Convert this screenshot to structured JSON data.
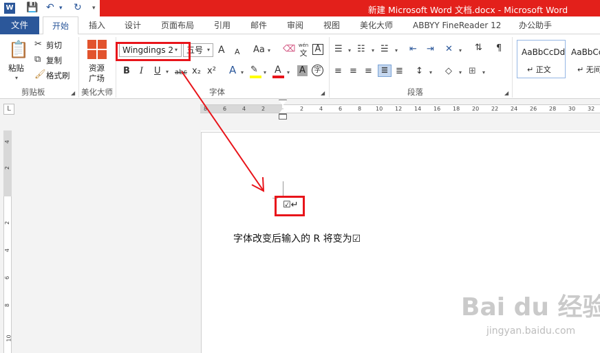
{
  "title_bar": {
    "title": "新建 Microsoft Word 文档.docx - Microsoft Word"
  },
  "tabs": [
    "文件",
    "开始",
    "插入",
    "设计",
    "页面布局",
    "引用",
    "邮件",
    "审阅",
    "视图",
    "美化大师",
    "ABBYY FineReader 12",
    "办公助手"
  ],
  "clipboard": {
    "paste": "粘贴",
    "cut": "剪切",
    "copy": "复制",
    "format_painter": "格式刷",
    "label": "剪贴板"
  },
  "beautify": {
    "resource_line1": "资源",
    "resource_line2": "广场",
    "label": "美化大师"
  },
  "font": {
    "name": "Wingdings 2",
    "size": "五号",
    "label": "字体",
    "grow": "A",
    "shrink": "A",
    "case": "Aa",
    "bold": "B",
    "italic": "I",
    "underline": "U",
    "strike": "abc",
    "sub": "x₂",
    "sup": "x²",
    "effects": "A",
    "color": "A",
    "char_shade": "A",
    "enclose": "字",
    "phonetic_top": "wén",
    "phonetic_main": "文",
    "char_border": "A"
  },
  "paragraph": {
    "label": "段落"
  },
  "styles": {
    "normal_sample": "AaBbCcDd",
    "normal_name": "↵ 正文",
    "nospace_sample": "AaBbCc",
    "nospace_name": "↵ 无间"
  },
  "ruler": {
    "top": [
      "8",
      "6",
      "4",
      "2",
      "2",
      "4",
      "6",
      "8",
      "10",
      "12",
      "14",
      "16",
      "18",
      "20",
      "22",
      "24",
      "26",
      "28",
      "30",
      "32"
    ],
    "left": [
      "4",
      "2",
      "2",
      "4",
      "6",
      "8",
      "10"
    ]
  },
  "document": {
    "symbol": "☑↵",
    "caption": "字体改变后输入的 R 将变为☑"
  },
  "watermark": {
    "main": "Bai du 经验",
    "sub": "jingyan.baidu.com"
  },
  "colors": {
    "title_red": "#e3201b",
    "accent": "#2b579a",
    "highlight": "#e8141a"
  }
}
